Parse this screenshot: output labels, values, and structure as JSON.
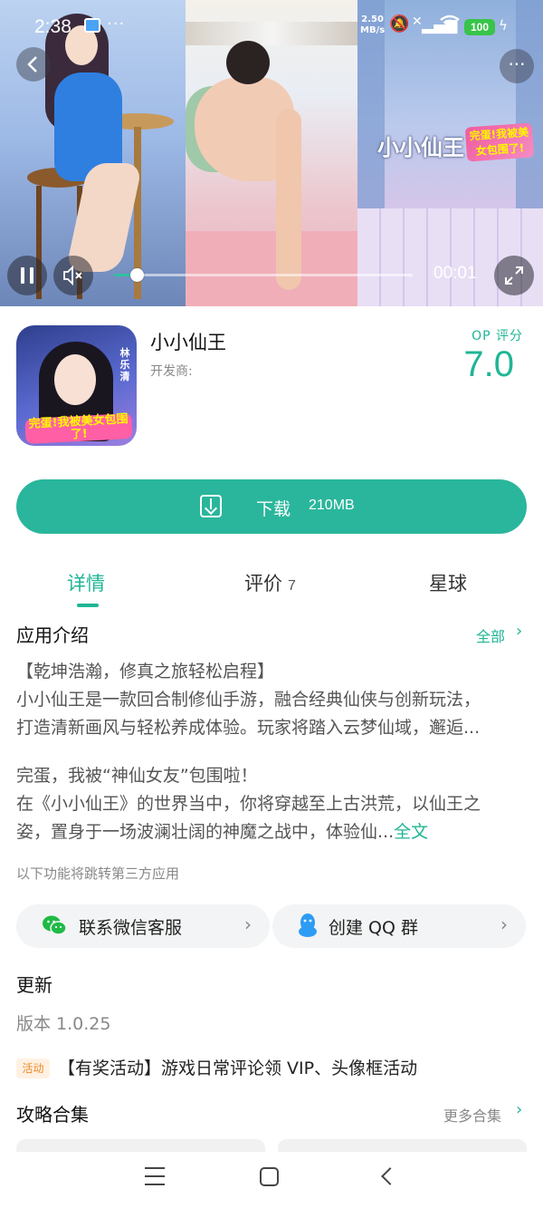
{
  "status_bar": {
    "time": "2:38",
    "more_dots": "···",
    "net_speed_value": "2.50",
    "net_speed_unit": "MB/s",
    "battery": "100"
  },
  "video": {
    "elapsed": "00:01",
    "progress_fraction": 0.08,
    "game_logo_title": "小小仙王",
    "game_logo_badge": "完蛋!我被美女包围了!"
  },
  "app": {
    "name": "小小仙王",
    "developer_label": "开发商:",
    "score_label": "OP 评分",
    "score": "7.0",
    "icon_vertical_text": "林乐清",
    "icon_badge": "完蛋!我被美女包围了!"
  },
  "download": {
    "label": "下载",
    "size": "210MB"
  },
  "tabs": [
    {
      "label": "详情",
      "active": true
    },
    {
      "label": "评价",
      "count": "7"
    },
    {
      "label": "星球"
    }
  ],
  "intro": {
    "title": "应用介绍",
    "see_all": "全部",
    "lines": [
      "【乾坤浩瀚，修真之旅轻松启程】",
      "小小仙王是一款回合制修仙手游，融合经典仙侠与创新玩法，",
      "打造清新画风与轻松养成体验。玩家将踏入云梦仙域，邂逅..."
    ],
    "lines2": [
      "完蛋，我被“神仙女友”包围啦！",
      "在《小小仙王》的世界当中，你将穿越至上古洪荒，以仙王之",
      "姿，置身于一场波澜壮阔的神魔之战中，体验仙..."
    ],
    "full_text": "全文",
    "third_party_note": "以下功能将跳转第三方应用"
  },
  "contacts": {
    "wechat": "联系微信客服",
    "qq": "创建 QQ 群"
  },
  "update": {
    "title": "更新",
    "version": "版本 1.0.25",
    "activity_tag": "活动",
    "activity_text": "【有奖活动】游戏日常评论领 VIP、头像框活动"
  },
  "guides": {
    "title": "攻略合集",
    "more": "更多合集"
  },
  "colors": {
    "accent": "#2ab69c",
    "accent_text": "#1fb595",
    "activity_tag": "#ef8a27"
  }
}
